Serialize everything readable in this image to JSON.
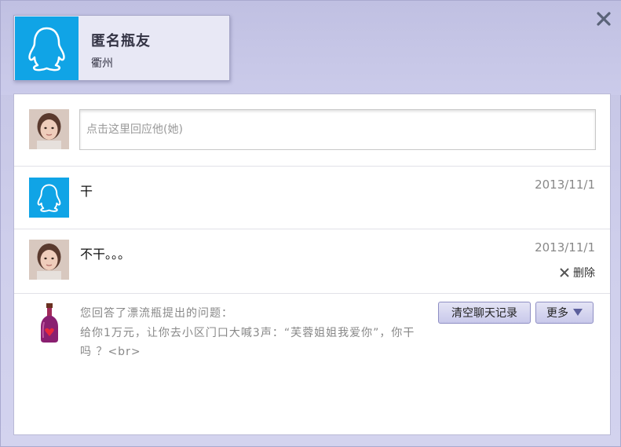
{
  "window": {
    "close_icon": "close-icon"
  },
  "profile": {
    "name": "匿名瓶友",
    "location": "衢州",
    "avatar_icon": "qq-penguin-icon"
  },
  "reply": {
    "placeholder": "点击这里回应他(她)"
  },
  "messages": [
    {
      "text": "干",
      "date": "2013/11/1",
      "sender": "qq"
    },
    {
      "text": "不干。。。",
      "date": "2013/11/1",
      "sender": "me",
      "delete_label": "删除"
    }
  ],
  "question": {
    "label": "您回答了漂流瓶提出的问题：",
    "text": "给你1万元，让你去小区门口大喊3声：“芙蓉姐姐我爱你”，你干吗 ？<br>",
    "icon": "bottle-icon"
  },
  "buttons": {
    "clear_label": "清空聊天记录",
    "more_label": "更多"
  },
  "colors": {
    "qq_blue": "#10a4e6",
    "frame_purple": "#c9c9e6"
  }
}
